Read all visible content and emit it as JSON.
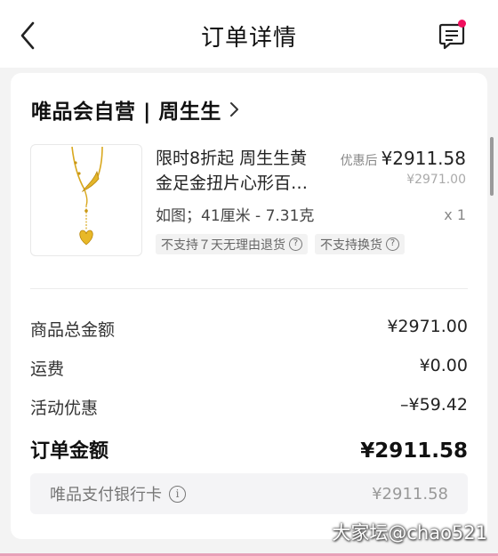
{
  "nav": {
    "title": "订单详情",
    "back_icon": "chevron-left-icon",
    "message_icon": "message-icon",
    "badge_color": "#f0105e"
  },
  "order": {
    "store": "唯品会自营 | 周生生",
    "product": {
      "name_line1": "限时8折起 周生生黄",
      "name_line2": "金足金扭片心形百…",
      "price_label": "优惠后",
      "price": "¥2911.58",
      "original_price": "¥2971.00",
      "spec": "如图；41厘米 - 7.31克",
      "qty": "x 1",
      "tags": [
        "不支持７天无理由退货",
        "不支持换货"
      ]
    },
    "summary": [
      {
        "label": "商品总金额",
        "value": "¥2971.00"
      },
      {
        "label": "运费",
        "value": "¥0.00"
      },
      {
        "label": "活动优惠",
        "value": "–¥59.42"
      }
    ],
    "total": {
      "label": "订单金额",
      "value": "¥2911.58"
    },
    "payment": {
      "label": "唯品支付银行卡",
      "value": "¥2911.58"
    }
  },
  "watermark": "大家坛@chao521"
}
